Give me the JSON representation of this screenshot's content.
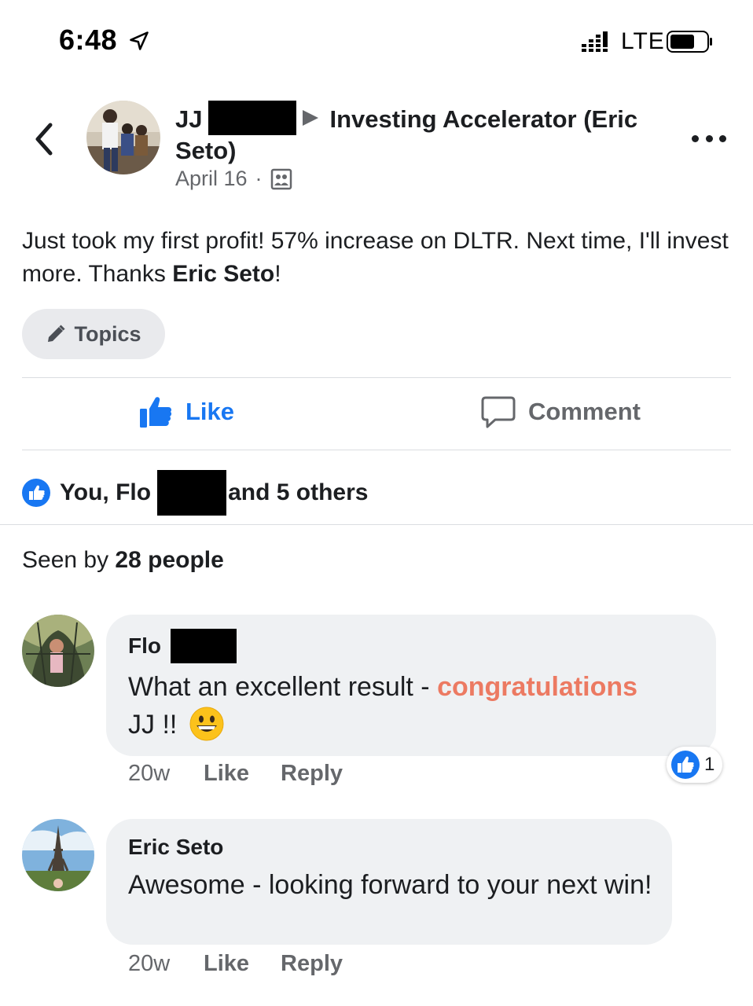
{
  "status_bar": {
    "time": "6:48",
    "network": "LTE"
  },
  "header": {
    "author_first": "JJ",
    "group_name": "Investing Accelerator (Eric Seto)",
    "group_name_line1": "Investing Accelerator (Eric",
    "group_name_line2": "Seto)",
    "date": "April 16",
    "separator": "·"
  },
  "post": {
    "text_before": "Just took my first profit!  57% increase on DLTR.  Next time, I'll invest more. Thanks ",
    "mention": "Eric Seto",
    "text_after": "!",
    "topics_label": "Topics"
  },
  "actions": {
    "like_label": "Like",
    "comment_label": "Comment"
  },
  "reactions": {
    "prefix": "You, Flo",
    "suffix": "and 5 others"
  },
  "seen_by": {
    "prefix": "Seen by ",
    "count_text": "28 people"
  },
  "comments": [
    {
      "author": "Flo",
      "text_before": "What an excellent result - ",
      "highlight": "congratulations",
      "text_after": "JJ !!",
      "time": "20w",
      "like_label": "Like",
      "reply_label": "Reply",
      "reaction_count": "1"
    },
    {
      "author": "Eric Seto",
      "text": "Awesome - looking forward to your next win!",
      "time": "20w",
      "like_label": "Like",
      "reply_label": "Reply"
    }
  ],
  "colors": {
    "accent_blue": "#1877f2",
    "secondary_text": "#65676b",
    "bubble_bg": "#eff1f3",
    "highlight": "#ec7a62"
  },
  "icons": [
    "location-arrow-icon",
    "signal-icon",
    "battery-icon",
    "back-chevron-icon",
    "more-dots-icon",
    "group-icon",
    "pencil-icon",
    "thumbs-up-icon",
    "comment-bubble-icon",
    "grinning-emoji-icon"
  ]
}
